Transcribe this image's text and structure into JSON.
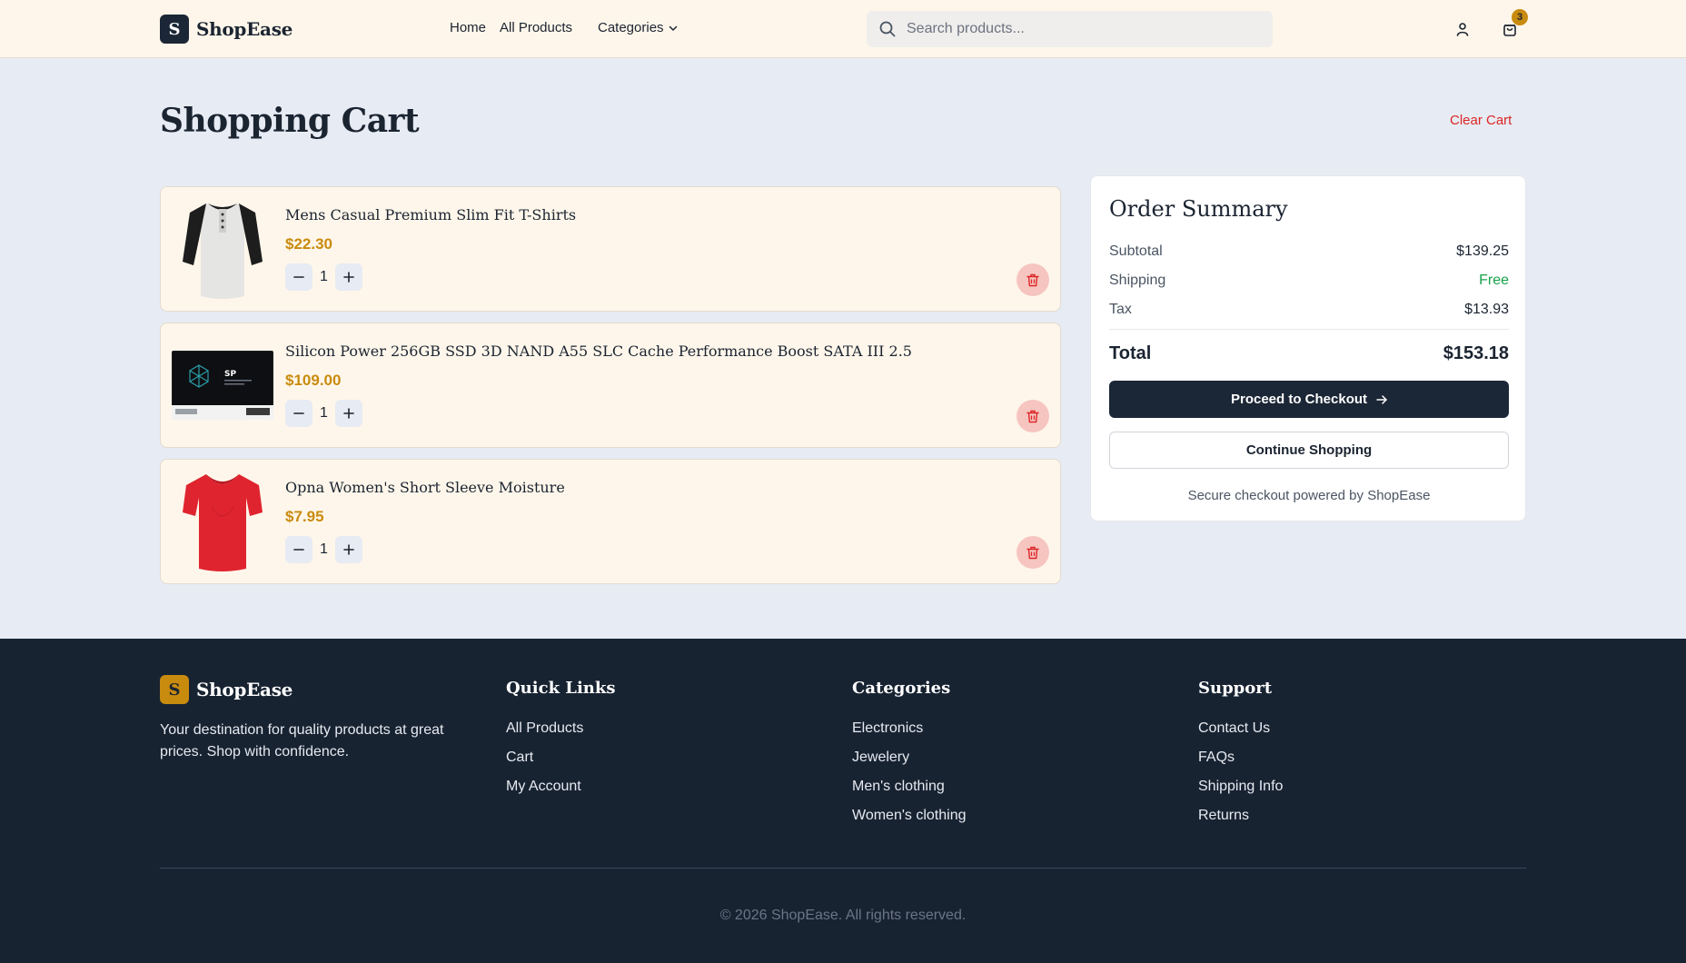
{
  "brand": {
    "name": "ShopEase",
    "logo_letter": "S"
  },
  "nav": {
    "home": "Home",
    "all_products": "All Products",
    "categories": "Categories"
  },
  "search": {
    "placeholder": "Search products..."
  },
  "cart_badge": "3",
  "page": {
    "title": "Shopping Cart",
    "clear_cart": "Clear Cart"
  },
  "cart_items": [
    {
      "name": "Mens Casual Premium Slim Fit T-Shirts",
      "price": "$22.30",
      "qty": "1",
      "image": "henley-shirt"
    },
    {
      "name": "Silicon Power 256GB SSD 3D NAND A55 SLC Cache Performance Boost SATA III 2.5",
      "price": "$109.00",
      "qty": "1",
      "image": "ssd-drive"
    },
    {
      "name": "Opna Women's Short Sleeve Moisture",
      "price": "$7.95",
      "qty": "1",
      "image": "red-tshirt"
    }
  ],
  "summary": {
    "title": "Order Summary",
    "subtotal_label": "Subtotal",
    "subtotal": "$139.25",
    "shipping_label": "Shipping",
    "shipping": "Free",
    "tax_label": "Tax",
    "tax": "$13.93",
    "total_label": "Total",
    "total": "$153.18",
    "checkout": "Proceed to Checkout",
    "continue": "Continue Shopping",
    "secure": "Secure checkout powered by ShopEase"
  },
  "footer": {
    "description": "Your destination for quality products at great prices. Shop with confidence.",
    "quick_links": {
      "title": "Quick Links",
      "items": [
        "All Products",
        "Cart",
        "My Account"
      ]
    },
    "categories": {
      "title": "Categories",
      "items": [
        "Electronics",
        "Jewelery",
        "Men's clothing",
        "Women's clothing"
      ]
    },
    "support": {
      "title": "Support",
      "items": [
        "Contact Us",
        "FAQs",
        "Shipping Info",
        "Returns"
      ]
    },
    "copyright": "© 2026 ShopEase. All rights reserved."
  },
  "colors": {
    "accent": "#c98b0e",
    "dark": "#1b2636",
    "danger": "#dc2626",
    "success": "#16a34a"
  }
}
